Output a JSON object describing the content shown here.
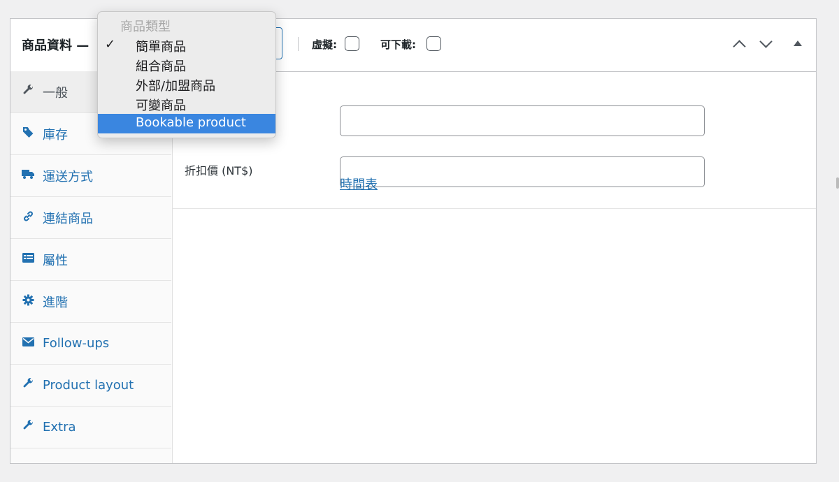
{
  "header": {
    "title": "商品資料 —",
    "virtual_label": "虛擬:",
    "downloadable_label": "可下載:"
  },
  "dropdown": {
    "header": "商品類型",
    "check_mark": "✓",
    "options": [
      {
        "label": "簡單商品",
        "selected": true
      },
      {
        "label": "組合商品",
        "selected": false
      },
      {
        "label": "外部/加盟商品",
        "selected": false
      },
      {
        "label": "可變商品",
        "selected": false
      },
      {
        "label": "Bookable product",
        "selected": false,
        "highlighted": true
      }
    ]
  },
  "tabs": [
    {
      "label": "一般",
      "icon": "wrench-icon",
      "active": true
    },
    {
      "label": "庫存",
      "icon": "tag-icon",
      "active": false
    },
    {
      "label": "運送方式",
      "icon": "truck-icon",
      "active": false
    },
    {
      "label": "連結商品",
      "icon": "link-icon",
      "active": false
    },
    {
      "label": "屬性",
      "icon": "list-icon",
      "active": false
    },
    {
      "label": "進階",
      "icon": "gear-icon",
      "active": false
    },
    {
      "label": "Follow-ups",
      "icon": "envelope-icon",
      "active": false
    },
    {
      "label": "Product layout",
      "icon": "wrench-icon",
      "active": false
    },
    {
      "label": "Extra",
      "icon": "wrench-icon",
      "active": false
    }
  ],
  "general": {
    "regular_price_value": "",
    "sale_price_label": "折扣價 (NT$)",
    "sale_price_value": "",
    "schedule_link": "時間表"
  },
  "colors": {
    "accent": "#2271b1",
    "highlight": "#3a86e0"
  }
}
